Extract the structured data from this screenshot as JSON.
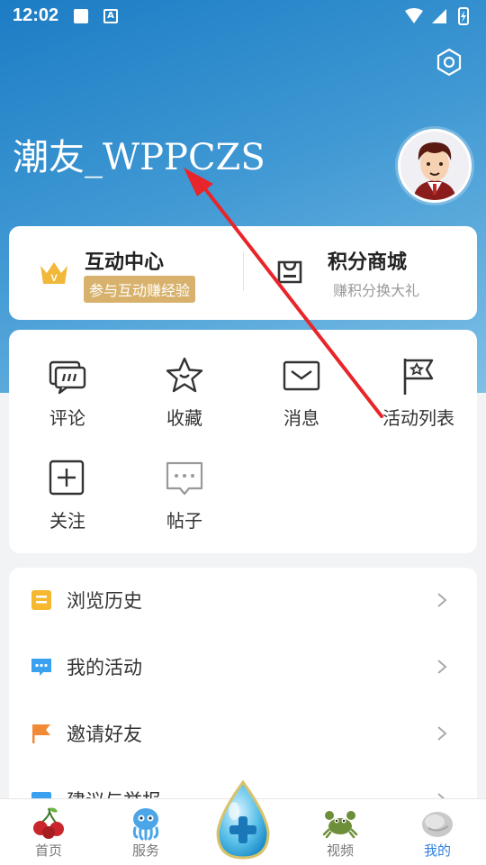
{
  "status_bar": {
    "time": "12:02"
  },
  "profile": {
    "username": "潮友_WPPCZS"
  },
  "top_card": {
    "interact": {
      "title": "互动中心",
      "subtitle": "参与互动赚经验"
    },
    "mall": {
      "title": "积分商城",
      "subtitle": "赚积分换大礼"
    }
  },
  "grid": {
    "items": [
      {
        "label": "评论",
        "icon": "comment-icon"
      },
      {
        "label": "收藏",
        "icon": "star-icon"
      },
      {
        "label": "消息",
        "icon": "mail-icon"
      },
      {
        "label": "活动列表",
        "icon": "flag-icon"
      },
      {
        "label": "关注",
        "icon": "plus-icon"
      },
      {
        "label": "帖子",
        "icon": "post-icon"
      }
    ]
  },
  "list": {
    "items": [
      {
        "label": "浏览历史",
        "icon": "history-icon",
        "color": "#f5b82e"
      },
      {
        "label": "我的活动",
        "icon": "activity-icon",
        "color": "#3aa0f0"
      },
      {
        "label": "邀请好友",
        "icon": "flag-orange-icon",
        "color": "#f08a35"
      },
      {
        "label": "建议与举报",
        "icon": "feedback-icon",
        "color": "#3aa0f0"
      }
    ]
  },
  "bottom_nav": {
    "items": [
      {
        "label": "首页",
        "icon": "cherry-icon",
        "active": false
      },
      {
        "label": "服务",
        "icon": "octopus-icon",
        "active": false
      },
      {
        "label": "",
        "icon": "center-drop-icon",
        "active": false
      },
      {
        "label": "视频",
        "icon": "crab-icon",
        "active": false
      },
      {
        "label": "我的",
        "icon": "shell-icon",
        "active": true
      }
    ]
  },
  "colors": {
    "hero_start": "#1c7cc4",
    "hero_end": "#7ec0e6",
    "accent": "#2f7fe0",
    "badge": "#d8b26c",
    "annotation_arrow": "#e8252a"
  }
}
